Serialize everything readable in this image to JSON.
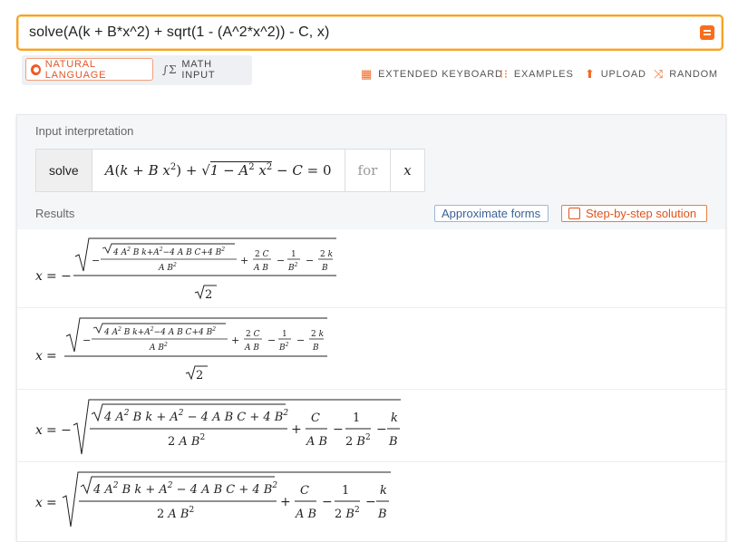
{
  "search": {
    "value": "solve(A(k + B*x^2) + sqrt(1 - (A^2*x^2)) - C, x)",
    "button_icon": "equals-icon"
  },
  "modes": {
    "natural": "NATURAL LANGUAGE",
    "math": "MATH INPUT"
  },
  "tools": {
    "keyboard": "EXTENDED KEYBOARD",
    "examples": "EXAMPLES",
    "upload": "UPLOAD",
    "random": "RANDOM"
  },
  "interpretation": {
    "title": "Input interpretation",
    "command": "solve",
    "for": "for",
    "variable": "x"
  },
  "results": {
    "title": "Results",
    "approx": "Approximate forms",
    "step": "Step-by-step solution"
  },
  "colors": {
    "accent": "#f96d1b",
    "link": "#3a6296",
    "highlight": "#f6a323"
  }
}
